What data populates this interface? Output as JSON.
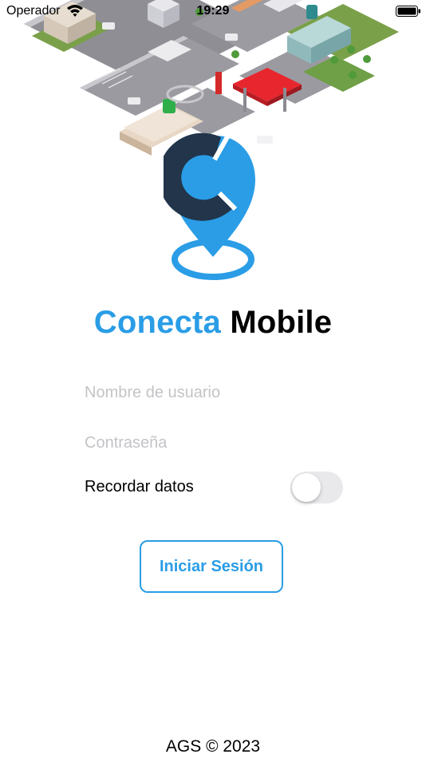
{
  "status_bar": {
    "carrier": "Operador",
    "time": "19:29"
  },
  "app": {
    "title_part1": "Conecta",
    "title_part2": "Mobile",
    "brand_color": "#2a9de6",
    "logo_dark_color": "#22354a"
  },
  "form": {
    "username_placeholder": "Nombre de usuario",
    "password_placeholder": "Contraseña",
    "remember_label": "Recordar datos",
    "remember_on": false,
    "login_label": "Iniciar Sesión"
  },
  "footer": {
    "text": "AGS © 2023"
  }
}
